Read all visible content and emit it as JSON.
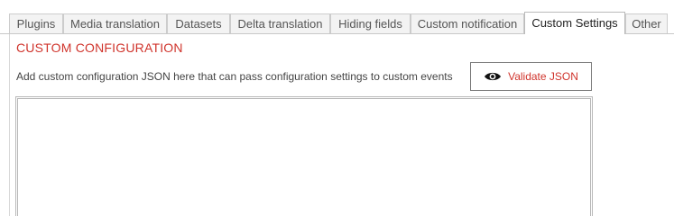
{
  "tabs": [
    {
      "label": "Plugins",
      "active": false
    },
    {
      "label": "Media translation",
      "active": false
    },
    {
      "label": "Datasets",
      "active": false
    },
    {
      "label": "Delta translation",
      "active": false
    },
    {
      "label": "Hiding fields",
      "active": false
    },
    {
      "label": "Custom notification",
      "active": false
    },
    {
      "label": "Custom Settings",
      "active": true
    },
    {
      "label": "Other",
      "active": false
    }
  ],
  "section": {
    "title": "CUSTOM CONFIGURATION",
    "description": "Add custom configuration JSON here that can pass configuration settings to custom events"
  },
  "validate_button": {
    "label": "Validate JSON",
    "icon": "eye-icon"
  },
  "editor": {
    "value": "",
    "placeholder": ""
  },
  "colors": {
    "accent": "#d0342c",
    "tab_bg": "#f3f3f3",
    "border": "#cccccc"
  }
}
